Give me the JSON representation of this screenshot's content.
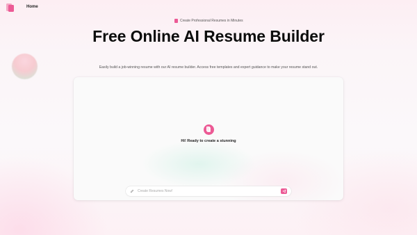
{
  "nav": {
    "home_label": "Home"
  },
  "hero": {
    "badge_text": "Create Professional Resumes in Minutes",
    "title": "Free Online AI Resume Builder",
    "subtitle": "Easily build a job-winning resume with our AI resume builder. Access free templates and expert guidance to make your resume stand out."
  },
  "chat": {
    "greeting": "Hi! Ready to create a stunning",
    "input_placeholder": "Create Resumes Now!",
    "input_value": ""
  },
  "icons": {
    "logo": "document-stack-icon",
    "badge": "document-icon",
    "assistant": "resume-icon",
    "input": "pencil-icon",
    "send": "send-icon"
  },
  "colors": {
    "accent": "#ec5a95",
    "accent_light": "#f4a6c3",
    "background": "#fbf6f8",
    "card": "#fafafa"
  }
}
